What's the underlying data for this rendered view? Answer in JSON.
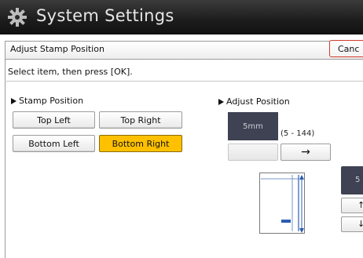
{
  "window": {
    "title": "System Settings",
    "icon": "gear-icon"
  },
  "header": {
    "label": "Adjust Stamp Position",
    "cancel_label": "Canc"
  },
  "instruction": "Select item, then press [OK].",
  "stamp_position": {
    "label": "Stamp Position",
    "options": [
      {
        "label": "Top Left",
        "selected": false
      },
      {
        "label": "Top Right",
        "selected": false
      },
      {
        "label": "Bottom Left",
        "selected": false
      },
      {
        "label": "Bottom Right",
        "selected": true
      }
    ]
  },
  "adjust_position": {
    "label": "Adjust Position",
    "value": "5mm",
    "range": "(5 - 144)",
    "right_arrow": "→"
  },
  "right_panel": {
    "value_fragment": "5",
    "buttons": [
      "↑",
      "↓"
    ]
  },
  "colors": {
    "selected": "#ffc000",
    "value_box": "#3e4252",
    "cancel_border": "#d23a2b",
    "marker": "#2a5db0"
  }
}
